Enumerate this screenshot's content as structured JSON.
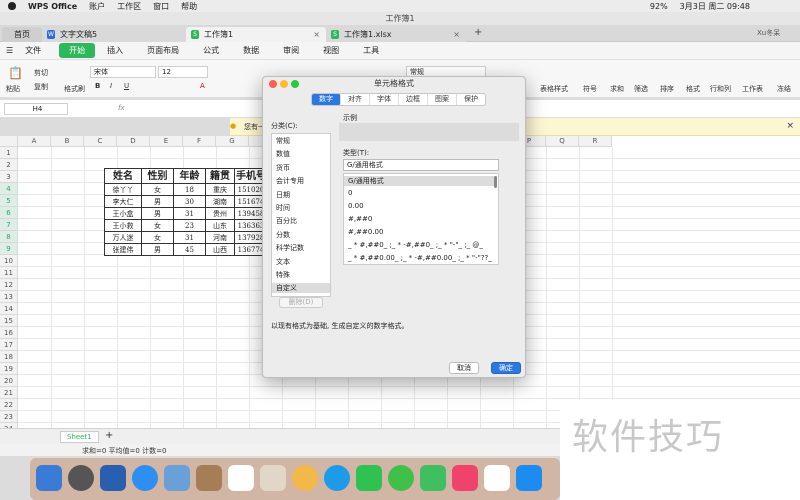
{
  "menubar": {
    "app": "WPS Office",
    "items": [
      "账户",
      "工作区",
      "窗口",
      "帮助"
    ],
    "battery": "92%",
    "datetime": "3月3日 周二  09:48"
  },
  "window": {
    "title": "工作簿1"
  },
  "tabs": [
    {
      "label": "首页"
    },
    {
      "label": "文字文稿5"
    },
    {
      "label": "工作簿1"
    },
    {
      "label": "工作簿1.xlsx"
    }
  ],
  "user": "Xu冬呆",
  "ribbon": {
    "file": "文件",
    "start": "开始",
    "items": [
      "插入",
      "页面布局",
      "公式",
      "数据",
      "审阅",
      "视图",
      "工具"
    ]
  },
  "toolbar": {
    "cut": "剪切",
    "copy": "复制",
    "format_painter": "格式刷",
    "paste": "粘贴",
    "font_name": "宋体",
    "font_size": "12",
    "number_format": "常规",
    "table_style": "表格样式",
    "symbol": "符号",
    "sum": "求和",
    "filter": "筛选",
    "sort": "排序",
    "format": "格式",
    "rowcol": "行和列",
    "sheet": "工作表",
    "freeze": "冻结"
  },
  "formula": {
    "cell_ref": "H4",
    "fx": "fx"
  },
  "notice": {
    "text": "您有一"
  },
  "grid": {
    "columns": [
      "A",
      "B",
      "C",
      "D",
      "E",
      "F",
      "G",
      "H",
      "I",
      "J",
      "K",
      "L",
      "M",
      "N",
      "O",
      "P",
      "Q",
      "R"
    ],
    "rows": [
      "1",
      "2",
      "3",
      "4",
      "5",
      "6",
      "7",
      "8",
      "9",
      "10",
      "11",
      "12",
      "13",
      "14",
      "15",
      "16",
      "17",
      "18",
      "19",
      "20",
      "21",
      "22",
      "23",
      "24"
    ],
    "table": {
      "headers": [
        "姓名",
        "性别",
        "年龄",
        "籍贯",
        "手机号"
      ],
      "rows": [
        [
          "徐丫丫",
          "女",
          "18",
          "重庆",
          "151020"
        ],
        [
          "李大仁",
          "男",
          "30",
          "湖南",
          "151674"
        ],
        [
          "王小盒",
          "男",
          "31",
          "贵州",
          "139458"
        ],
        [
          "王小救",
          "女",
          "23",
          "山东",
          "136363"
        ],
        [
          "万人迷",
          "女",
          "31",
          "河南",
          "137928"
        ],
        [
          "张建伟",
          "男",
          "45",
          "山西",
          "136774"
        ]
      ]
    }
  },
  "sheet_tabs": {
    "active": "Sheet1",
    "add": "+"
  },
  "status": {
    "text": "求和=0  平均值=0  计数=0"
  },
  "watermark": "软件技巧",
  "dialog": {
    "title": "单元格格式",
    "tabs": [
      "数字",
      "对齐",
      "字体",
      "边框",
      "图案",
      "保护"
    ],
    "category_label": "分类(C):",
    "categories": [
      "常规",
      "数值",
      "货币",
      "会计专用",
      "日期",
      "时间",
      "百分比",
      "分数",
      "科学记数",
      "文本",
      "特殊",
      "自定义"
    ],
    "selected_category": "自定义",
    "sample_label": "示例",
    "type_label": "类型(T):",
    "type_value": "G/通用格式",
    "types": [
      "G/通用格式",
      "0",
      "0.00",
      "#,##0",
      "#,##0.00",
      "_ * #,##0_ ;_ * -#,##0_ ;_ * \"-\"_ ;_ @_",
      "_ * #,##0.00_ ;_ * -#,##0.00_ ;_ * \"-\"??_"
    ],
    "delete_button": "删除(D)",
    "description": "以现有格式为基础, 生成自定义的数字格式。",
    "cancel": "取消",
    "ok": "确定"
  },
  "colors": {
    "accent": "#2d78e0",
    "start": "#2fb85b",
    "notice_bg": "#fdf6d3"
  }
}
